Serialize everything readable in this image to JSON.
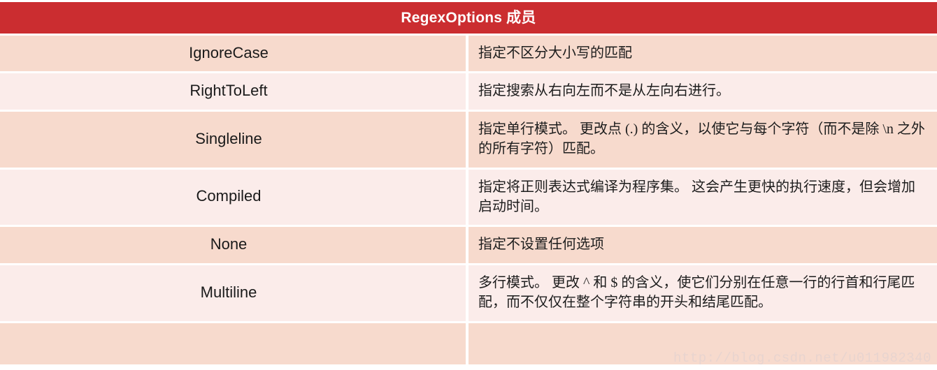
{
  "table": {
    "title": "RegexOptions 成员",
    "accent_color": "#cb2d30",
    "row_color_odd": "#f7dacd",
    "row_color_even": "#fbecea",
    "rows": [
      {
        "name": "IgnoreCase",
        "description": "指定不区分大小写的匹配"
      },
      {
        "name": "RightToLeft",
        "description": "指定搜索从右向左而不是从左向右进行。"
      },
      {
        "name": "Singleline",
        "description": "指定单行模式。 更改点 (.) 的含义，以使它与每个字符（而不是除 \\n 之外的所有字符）匹配。"
      },
      {
        "name": "Compiled",
        "description": "指定将正则表达式编译为程序集。 这会产生更快的执行速度，但会增加启动时间。"
      },
      {
        "name": "None",
        "description": "指定不设置任何选项"
      },
      {
        "name": "Multiline",
        "description": "多行模式。 更改 ^ 和 $ 的含义，使它们分别在任意一行的行首和行尾匹配，而不仅仅在整个字符串的开头和结尾匹配。"
      },
      {
        "name": "",
        "description": ""
      }
    ]
  },
  "watermark": {
    "text": "http://blog.csdn.net/u011982340"
  }
}
